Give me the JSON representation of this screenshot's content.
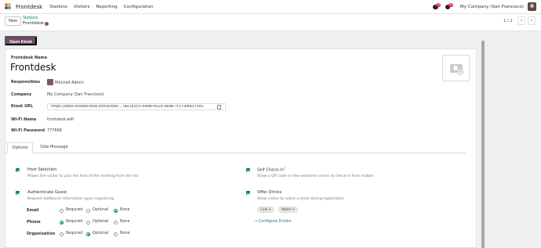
{
  "nav": {
    "app_name": "Frontdesk",
    "menu": [
      "Stations",
      "Visitors",
      "Reporting",
      "Configuration"
    ],
    "messages_badge": "13",
    "activities_badge": "32",
    "company": "My Company (San Francisco)"
  },
  "control": {
    "new_label": "New",
    "breadcrumb_parent": "Stations",
    "breadcrumb_current": "Frontdesk",
    "pager": "1 / 2",
    "prev": "‹",
    "next": "›"
  },
  "form": {
    "open_kiosk": "Open Kiosk",
    "name_label": "Frontdesk Name",
    "name_value": "Frontdesk",
    "fields": {
      "responsibles_label": "Responsibles",
      "responsibles_value": "Mitchell Admin",
      "company_label": "Company",
      "company_value": "My Company (San Francisco)",
      "kiosk_url_label": "Kiosk URL",
      "kiosk_url_value": "https://odoo-entastcloud.com/kiosk/...?a018355-44de-4016-9e9e-7f3799fa375e1",
      "wifi_name_label": "Wi-Fi Name",
      "wifi_name_value": "frontdesk-wifi",
      "wifi_password_label": "Wi-Fi Password",
      "wifi_password_value": "777666"
    },
    "tabs": [
      "Options",
      "Side Message"
    ],
    "options": {
      "host_title": "Host Selection",
      "host_desc": "Allows the visitor to pick the host of the meeting from the list",
      "auth_title": "Authenticate Guest",
      "auth_desc": "Request additional information upon registering",
      "self_title": "Self Check-In",
      "self_sup": "?",
      "self_desc": "Show a QR code on the welcome screen to check-in from mobile",
      "drinks_title": "Offer Drinks",
      "drinks_desc": "Allow visitor to select a drink during registration",
      "drink_tags": [
        "Cola ✕",
        "Water ✕"
      ],
      "configure_drinks": "→ Configure Drinks",
      "radio_options": [
        "Required",
        "Optional",
        "None"
      ],
      "radio_rows": [
        {
          "label": "Email",
          "selected": "None"
        },
        {
          "label": "Phone",
          "selected": "Required"
        },
        {
          "label": "Organization",
          "selected": "Optional"
        }
      ]
    }
  },
  "colors": {
    "primary": "#714b67",
    "accent": "#017e84",
    "badge": "#e0215d"
  }
}
